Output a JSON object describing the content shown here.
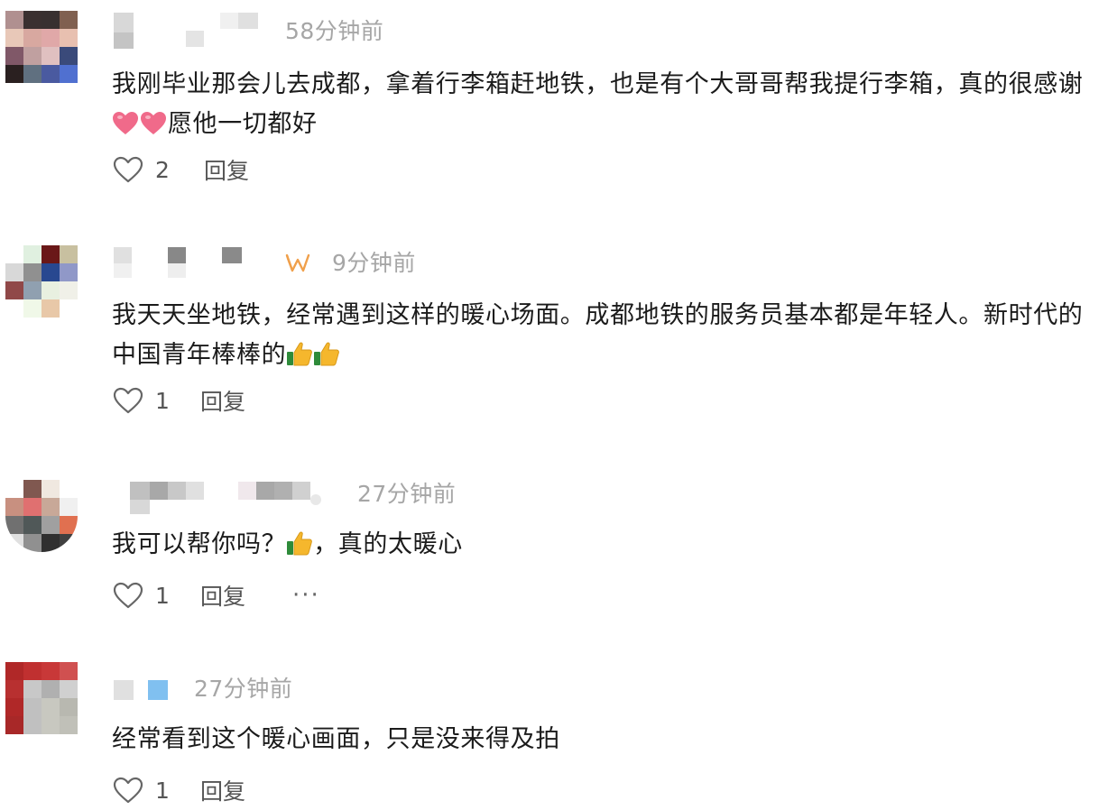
{
  "comments": [
    {
      "time": "58分钟前",
      "text_before": "我刚毕业那会儿去成都，拿着行李箱赶地铁，也是有个大哥哥帮我提行李箱，真的很感谢",
      "emoji": "heart-emoji",
      "text_after": "愿他一切都好",
      "likes": "2",
      "reply_label": "回复"
    },
    {
      "time": "9分钟前",
      "text_before": "我天天坐地铁，经常遇到这样的暖心场面。成都地铁的服务员基本都是年轻人。新时代的中国青年棒棒的",
      "emoji": "thumbs-up-emoji",
      "text_after": "",
      "likes": "1",
      "reply_label": "回复"
    },
    {
      "time": "27分钟前",
      "text_before": "我可以帮你吗？",
      "emoji": "thumbs-up-emoji",
      "text_after": "，真的太暖心",
      "likes": "1",
      "reply_label": "回复",
      "more_label": "···"
    },
    {
      "time": "27分钟前",
      "text_before": "经常看到这个暖心画面，只是没来得及拍",
      "emoji": "",
      "text_after": "",
      "likes": "1",
      "reply_label": "回复"
    }
  ],
  "colors": {
    "time": "#a6a6a6",
    "text": "#1b1b1b",
    "action": "#555555",
    "badge": "#f0a04b",
    "heart_emoji": "#f06a8a",
    "thumb": "#f5b72d"
  }
}
